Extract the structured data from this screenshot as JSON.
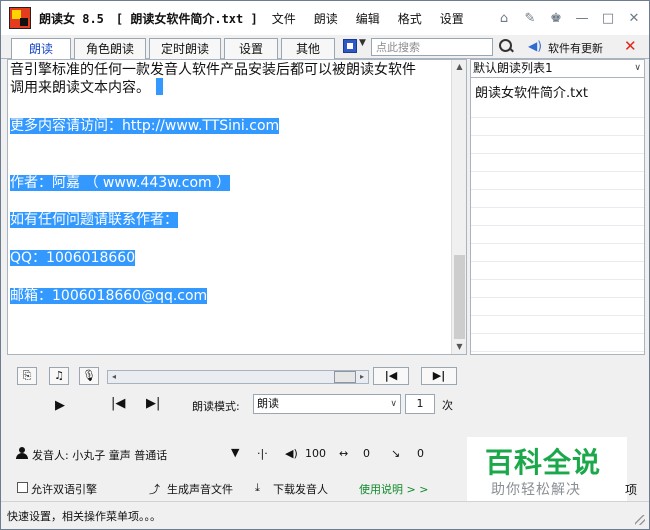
{
  "app": {
    "name": "朗读女 8.5",
    "document": "[ 朗读女软件简介.txt ]"
  },
  "menu": [
    "文件",
    "朗读",
    "编辑",
    "格式",
    "设置"
  ],
  "title_icons": [
    "home-icon",
    "tools-icon",
    "skin-icon",
    "minimize-icon",
    "maximize-icon",
    "close-icon"
  ],
  "tabs": [
    "朗读",
    "角色朗读",
    "定时朗读",
    "设置",
    "其他"
  ],
  "active_tab": 0,
  "search": {
    "placeholder": "点此搜索"
  },
  "update_label": "软件有更新",
  "text": {
    "line1": "音引擎标准的任何一款发音人软件产品安装后都可以被朗读女软件",
    "line2": "调用来朗读文本内容。",
    "line3": "更多内容请访问：http://www.TTSini.com",
    "line4": "作者：阿嘉  （ www.443w.com ）",
    "line5": "如有任何问题请联系作者：",
    "line6": "QQ：1006018660",
    "line7": "邮箱：1006018660@qq.com"
  },
  "playlist": {
    "selected": "默认朗读列表1",
    "items": [
      "朗读女软件简介.txt"
    ]
  },
  "controls": {
    "mode_label": "朗读模式:",
    "mode_value": "朗读",
    "repeat_count": "1",
    "times_label": "次"
  },
  "voice": {
    "label": "发音人: 小丸子 童声 普通话",
    "volume": "100",
    "speed": "0",
    "pitch": "0"
  },
  "options": {
    "dual_engine": "允许双语引擎",
    "generate_audio": "生成声音文件",
    "download_voice": "下载发音人",
    "help_link": "使用说明 > >",
    "tail": "项"
  },
  "status": "快速设置，相关操作菜单项。。。",
  "watermark": {
    "title": "百科全说",
    "subtitle": "助你轻松解决"
  },
  "colors": {
    "selection": "#3399ff",
    "accent_tab": "#1a49c8",
    "close_red": "#e0271b",
    "help_green": "#118a2c",
    "watermark_green": "#1aa84a"
  }
}
